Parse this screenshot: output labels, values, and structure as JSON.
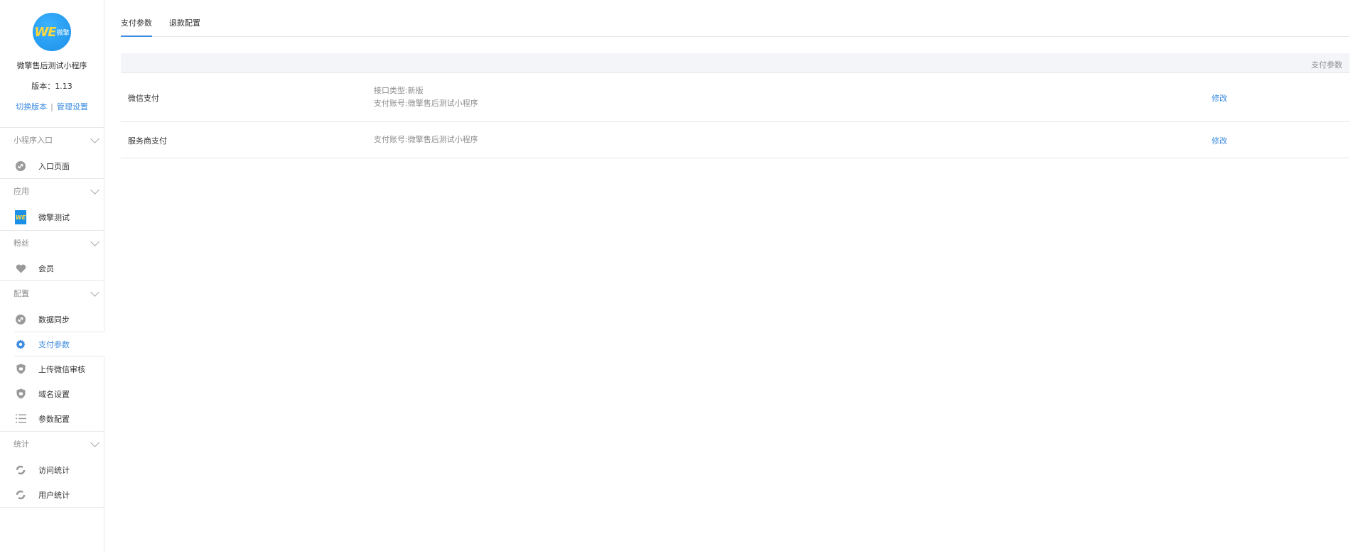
{
  "sidebar": {
    "logo_text": "WE",
    "logo_sub": "微擎",
    "app_name": "微擎售后测试小程序",
    "version": "版本：1.13",
    "switch_version": "切换版本",
    "manage_settings": "管理设置",
    "groups": [
      {
        "title": "小程序入口",
        "items": [
          {
            "label": "入口页面",
            "icon": "link-icon"
          }
        ]
      },
      {
        "title": "应用",
        "items": [
          {
            "label": "微擎测试",
            "icon": "app-thumbnail"
          }
        ]
      },
      {
        "title": "粉丝",
        "items": [
          {
            "label": "会员",
            "icon": "heart-icon"
          }
        ]
      },
      {
        "title": "配置",
        "items": [
          {
            "label": "数据同步",
            "icon": "link-icon"
          },
          {
            "label": "支付参数",
            "icon": "gear-icon"
          },
          {
            "label": "上传微信审核",
            "icon": "shield-icon"
          },
          {
            "label": "域名设置",
            "icon": "shield-icon"
          },
          {
            "label": "参数配置",
            "icon": "list-icon"
          }
        ]
      },
      {
        "title": "统计",
        "items": [
          {
            "label": "访问统计",
            "icon": "refresh-icon"
          },
          {
            "label": "用户统计",
            "icon": "refresh-icon"
          }
        ]
      }
    ]
  },
  "tabs": [
    {
      "label": "支付参数",
      "active": true
    },
    {
      "label": "退款配置",
      "active": false
    }
  ],
  "table": {
    "header": "支付参数",
    "rows": [
      {
        "name": "微信支付",
        "detail_line1": "接口类型:新版",
        "detail_line2": "支付账号:微擎售后测试小程序",
        "action": "修改"
      },
      {
        "name": "服务商支付",
        "detail_line1": "支付账号:微擎售后测试小程序",
        "action": "修改"
      }
    ]
  },
  "colors": {
    "accent": "#3d8ce0",
    "border": "#e7e7eb",
    "header_bg": "#f4f5f9",
    "muted_text": "#8d8d8d"
  }
}
